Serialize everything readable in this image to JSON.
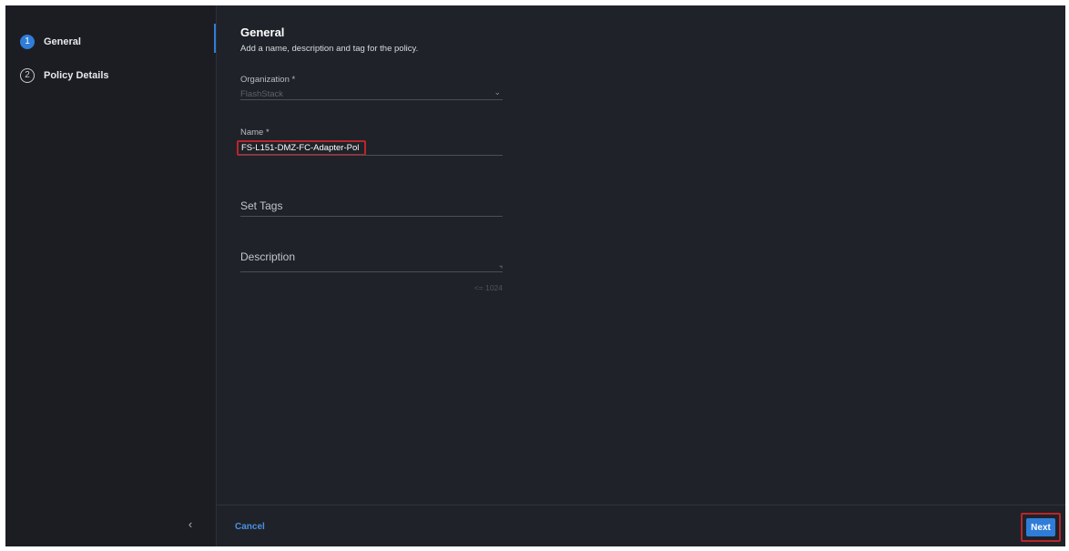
{
  "colors": {
    "background": "#1f2228",
    "sidebar": "#1b1d23",
    "accent": "#2f7dd8",
    "highlight": "#b8262b"
  },
  "sidebar": {
    "steps": [
      {
        "number": "1",
        "label": "General",
        "active": true
      },
      {
        "number": "2",
        "label": "Policy Details",
        "active": false
      }
    ],
    "collapse_icon": "chevron-left-icon"
  },
  "main": {
    "title": "General",
    "subtitle": "Add a name, description and tag for the policy.",
    "organization": {
      "label": "Organization *",
      "value": "FlashStack"
    },
    "name": {
      "label": "Name *",
      "value": "FS-L151-DMZ-FC-Adapter-Pol"
    },
    "tags": {
      "placeholder": "Set Tags"
    },
    "description": {
      "placeholder": "Description",
      "counter": "<= 1024"
    }
  },
  "footer": {
    "cancel_label": "Cancel",
    "next_label": "Next"
  }
}
